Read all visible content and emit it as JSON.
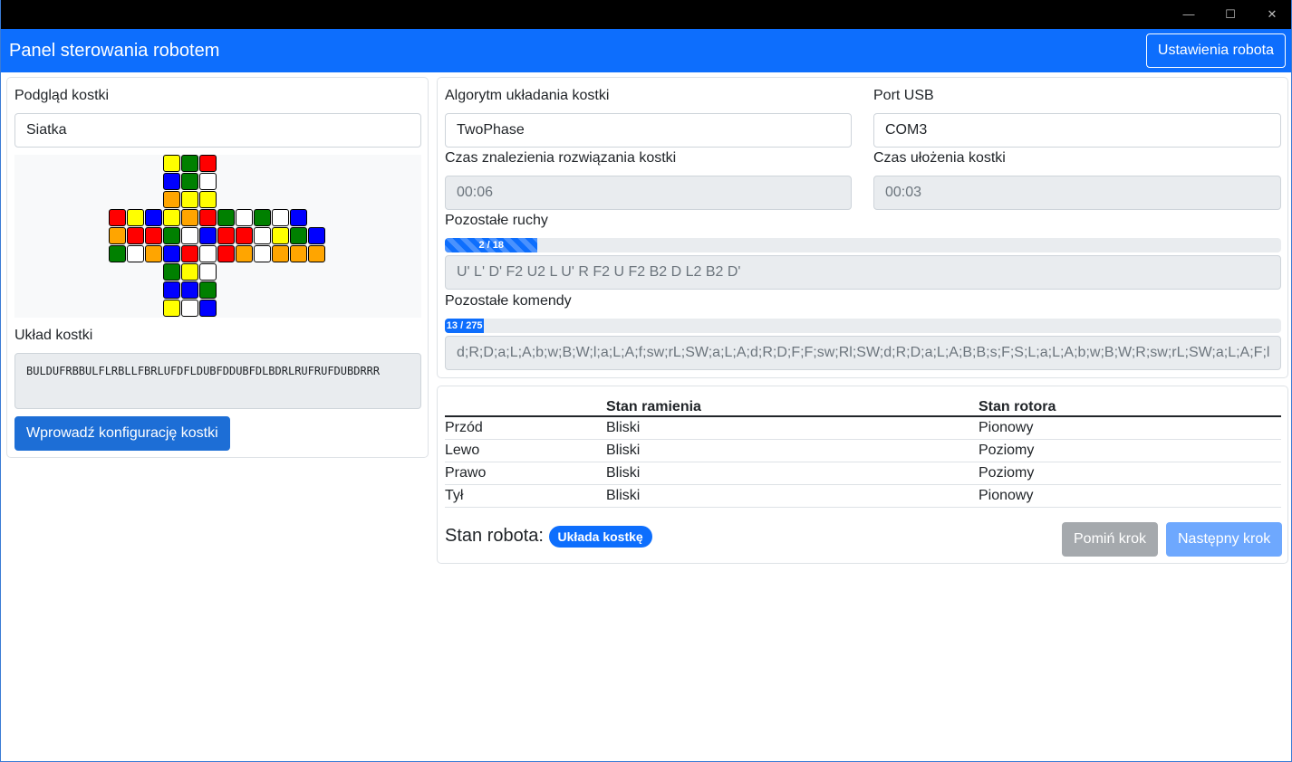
{
  "window": {
    "controls": [
      "—",
      "☐",
      "✕"
    ]
  },
  "navbar": {
    "title": "Panel sterowania robotem",
    "settings_button": "Ustawienia robota"
  },
  "left": {
    "preview_label": "Podgląd kostki",
    "view_mode": "Siatka",
    "layout_label": "Układ kostki",
    "layout_value": "BULDUFRBBULFLRBLLFBRLUFDFLDUBFDDUBFDLBDRLRUFRUFDUBDRRR",
    "configure_button": "Wprowadź konfigurację kostki"
  },
  "colors": {
    "Y": "#ffff00",
    "G": "#008000",
    "R": "#ff0000",
    "B": "#0000ff",
    "W": "#ffffff",
    "O": "#ffa500"
  },
  "net": {
    "up": [
      "YGR",
      "BGW",
      "OYY"
    ],
    "middle": [
      "RYBYORGWGWB",
      "ORRGWBRRWYGB",
      "GWOBRWROWOOO"
    ],
    "down": [
      "GYW",
      "BBG",
      "YWB"
    ]
  },
  "right": {
    "algorithm_label": "Algorytm układania kostki",
    "algorithm_value": "TwoPhase",
    "port_label": "Port USB",
    "port_value": "COM3",
    "solve_time_label": "Czas znalezienia rozwiązania kostki",
    "solve_time_value": "00:06",
    "arrange_time_label": "Czas ułożenia kostki",
    "arrange_time_value": "00:03",
    "moves_label": "Pozostałe ruchy",
    "moves_progress_text": "2 / 18",
    "moves_progress": 0.111,
    "moves_value": "U' L' D' F2 U2 L U' R F2 U F2 B2 D L2 B2 D'",
    "commands_label": "Pozostałe komendy",
    "commands_progress_text": "13 / 275",
    "commands_progress": 0.047,
    "commands_value": "d;R;D;a;L;A;b;w;B;W;l;a;L;A;f;sw;rL;SW;a;L;A;d;R;D;F;F;sw;Rl;SW;d;R;D;a;L;A;B;B;s;F;S;L;a;L;A;b;w;B;W;R;sw;rL;SW;a;L;A;F;l"
  },
  "status": {
    "headers": [
      "",
      "Stan ramienia",
      "Stan rotora"
    ],
    "rows": [
      [
        "Przód",
        "Bliski",
        "Pionowy"
      ],
      [
        "Lewo",
        "Bliski",
        "Poziomy"
      ],
      [
        "Prawo",
        "Bliski",
        "Poziomy"
      ],
      [
        "Tył",
        "Bliski",
        "Pionowy"
      ]
    ],
    "robot_state_label": "Stan robota:",
    "robot_state_badge": "Układa kostkę",
    "skip_button": "Pomiń krok",
    "next_button": "Następny krok"
  }
}
